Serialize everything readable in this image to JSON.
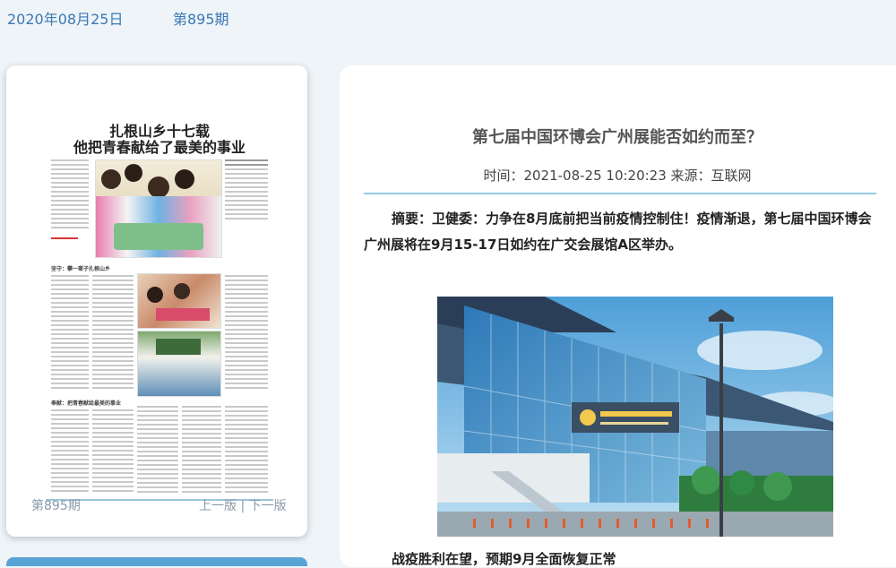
{
  "header": {
    "date": "2020年08月25日",
    "issue": "第895期"
  },
  "left_panel": {
    "newspaper": {
      "headline_line1": "扎根山乡十七载",
      "headline_line2": "他把青春献给了最美的事业",
      "subhead_1": "坚守：攀一辈子扎根山乡",
      "subhead_2": "奉献：把青春献给最美的事业"
    },
    "issue_label": "第895期",
    "prev_label": "上一版",
    "separator": "|",
    "next_label": "下一版"
  },
  "article": {
    "title": "第七届中国环博会广州展能否如约而至？",
    "meta": "时间：2021-08-25 10:20:23  来源：互联网",
    "summary": "摘要：卫健委：力争在8月底前把当前疫情控制住！疫情渐退，第七届中国环博会广州展将在9月15-17日如约在广交会展馆A区举办。",
    "subheading": "战疫胜利在望，预期9月全面恢复正常"
  }
}
